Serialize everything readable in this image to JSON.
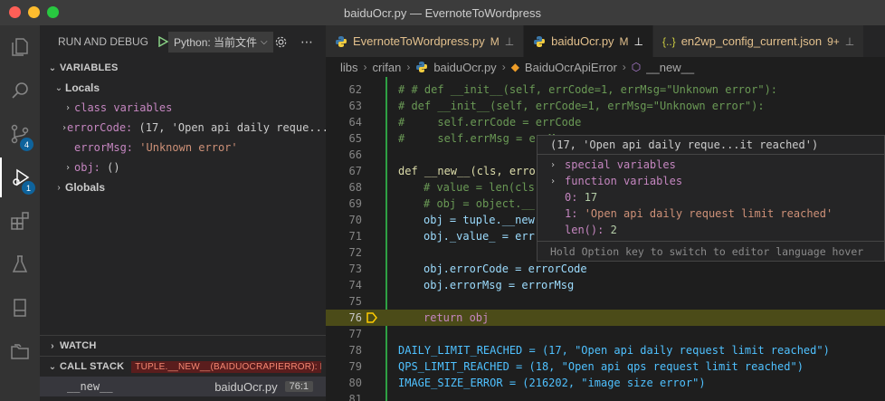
{
  "window": {
    "title": "baiduOcr.py — EvernoteToWordpress"
  },
  "activity": {
    "scm_badge": "4",
    "debug_badge": "1"
  },
  "sidebar": {
    "header": "RUN AND DEBUG",
    "config": "Python: 当前文件",
    "variables": {
      "title": "VARIABLES",
      "locals": "Locals",
      "items": [
        {
          "name": "class variables",
          "value": ""
        },
        {
          "name": "errorCode:",
          "value": "(17, 'Open api daily reque...it reached')"
        },
        {
          "name": "errorMsg:",
          "value": "'Unknown error'"
        },
        {
          "name": "obj:",
          "value": "()"
        }
      ],
      "globals": "Globals"
    },
    "watch": {
      "title": "WATCH"
    },
    "callstack": {
      "title": "CALL STACK",
      "badge": "TUPLE.__NEW__(BAIDUOCRAPIERROR): BAI...",
      "frames": [
        {
          "name": "__new__",
          "file": "baiduOcr.py",
          "line": "76:1"
        }
      ]
    }
  },
  "tabs": [
    {
      "label": "EvernoteToWordpress.py",
      "mod": "M",
      "active": false
    },
    {
      "label": "baiduOcr.py",
      "mod": "M",
      "active": true
    },
    {
      "label": "en2wp_config_current.json",
      "mod": "9+",
      "active": false
    }
  ],
  "breadcrumb": [
    "libs",
    "crifan",
    "baiduOcr.py",
    "BaiduOcrApiError",
    "__new__"
  ],
  "editor": {
    "lines": [
      {
        "n": "62",
        "text": "# # def __init__(self, errCode=1, errMsg=\"Unknown error\"):"
      },
      {
        "n": "63",
        "text": "# def __init__(self, errCode=1, errMsg=\"Unknown error\"):"
      },
      {
        "n": "64",
        "text": "#     self.errCode = errCode"
      },
      {
        "n": "65",
        "text": "#     self.errMsg = errMsg"
      },
      {
        "n": "66",
        "text": ""
      },
      {
        "n": "67",
        "text": "def __new__(cls, errorCode, errorMsg):"
      },
      {
        "n": "68",
        "text": "# value = len(cls"
      },
      {
        "n": "69",
        "text": "# obj = object.__"
      },
      {
        "n": "70",
        "text": "obj = tuple.__new"
      },
      {
        "n": "71",
        "text": "obj._value_ = err"
      },
      {
        "n": "72",
        "text": ""
      },
      {
        "n": "73",
        "text": "obj.errorCode = errorCode"
      },
      {
        "n": "74",
        "text": "obj.errorMsg = errorMsg"
      },
      {
        "n": "75",
        "text": ""
      },
      {
        "n": "76",
        "text": "return obj"
      },
      {
        "n": "77",
        "text": ""
      },
      {
        "n": "78",
        "text": "DAILY_LIMIT_REACHED = (17, \"Open api daily request limit reached\")"
      },
      {
        "n": "79",
        "text": "QPS_LIMIT_REACHED = (18, \"Open api qps request limit reached\")"
      },
      {
        "n": "80",
        "text": "IMAGE_SIZE_ERROR = (216202, \"image size error\")"
      },
      {
        "n": "81",
        "text": ""
      }
    ]
  },
  "hover": {
    "title": "(17, 'Open api daily reque...it reached')",
    "special": "special variables",
    "function": "function variables",
    "item0_key": "0:",
    "item0_val": "17",
    "item1_key": "1:",
    "item1_val": "'Open api daily request limit reached'",
    "len_key": "len():",
    "len_val": "2",
    "footer": "Hold Option key to switch to editor language hover"
  },
  "colors": {
    "accent": "#0e639c",
    "highlight_line": "#4b4b18",
    "modified": "#e2c08d"
  }
}
